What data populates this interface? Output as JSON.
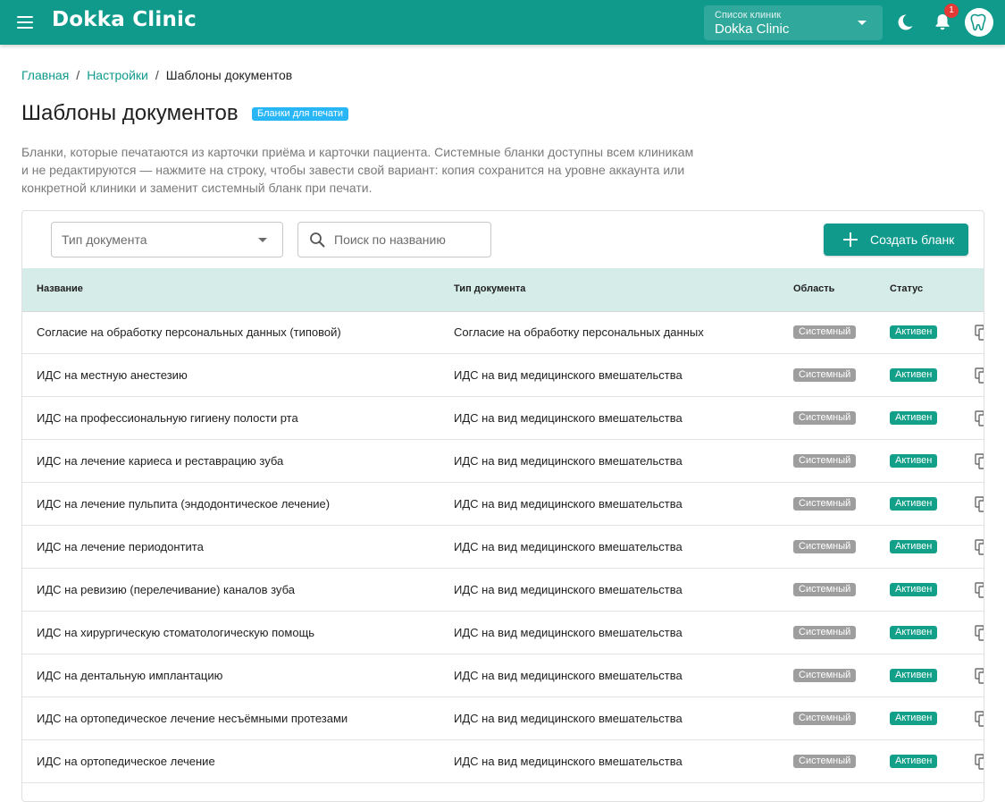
{
  "app": {
    "brand": "Dokka Clinic",
    "clinic_select": {
      "label": "Список клиник",
      "value": "Dokka Clinic"
    },
    "notifications_count": "1",
    "colors": {
      "primary": "#0f9a8c",
      "header_row": "#d5ece9",
      "chip_info": "#29b6f6",
      "chip_system": "#9e9e9e",
      "chip_active": "#12a089",
      "badge": "#e53935"
    }
  },
  "breadcrumb": {
    "home": "Главная",
    "settings": "Настройки",
    "current": "Шаблоны документов"
  },
  "page": {
    "title": "Шаблоны документов",
    "chip": "Бланки для печати",
    "description": "Бланки, которые печатаются из карточки приёма и карточки пациента. Системные бланки доступны всем клиникам и не редактируются — нажмите на строку, чтобы завести свой вариант: копия сохранится на уровне аккаунта или конкретной клиники и заменит системный бланк при печати."
  },
  "toolbar": {
    "type_filter_placeholder": "Тип документа",
    "search_placeholder": "Поиск по названию",
    "create_label": "Создать бланк"
  },
  "table": {
    "headers": {
      "name": "Название",
      "type": "Тип документа",
      "scope": "Область",
      "status": "Статус"
    },
    "rows": [
      {
        "name": "Согласие на обработку персональных данных (типовой)",
        "type": "Согласие на обработку персональных данных",
        "scope": "Системный",
        "status": "Активен"
      },
      {
        "name": "ИДС на местную анестезию",
        "type": "ИДС на вид медицинского вмешательства",
        "scope": "Системный",
        "status": "Активен"
      },
      {
        "name": "ИДС на профессиональную гигиену полости рта",
        "type": "ИДС на вид медицинского вмешательства",
        "scope": "Системный",
        "status": "Активен"
      },
      {
        "name": "ИДС на лечение кариеса и реставрацию зуба",
        "type": "ИДС на вид медицинского вмешательства",
        "scope": "Системный",
        "status": "Активен"
      },
      {
        "name": "ИДС на лечение пульпита (эндодонтическое лечение)",
        "type": "ИДС на вид медицинского вмешательства",
        "scope": "Системный",
        "status": "Активен"
      },
      {
        "name": "ИДС на лечение периодонтита",
        "type": "ИДС на вид медицинского вмешательства",
        "scope": "Системный",
        "status": "Активен"
      },
      {
        "name": "ИДС на ревизию (перелечивание) каналов зуба",
        "type": "ИДС на вид медицинского вмешательства",
        "scope": "Системный",
        "status": "Активен"
      },
      {
        "name": "ИДС на хирургическую стоматологическую помощь",
        "type": "ИДС на вид медицинского вмешательства",
        "scope": "Системный",
        "status": "Активен"
      },
      {
        "name": "ИДС на дентальную имплантацию",
        "type": "ИДС на вид медицинского вмешательства",
        "scope": "Системный",
        "status": "Активен"
      },
      {
        "name": "ИДС на ортопедическое лечение несъёмными протезами",
        "type": "ИДС на вид медицинского вмешательства",
        "scope": "Системный",
        "status": "Активен"
      },
      {
        "name": "ИДС на ортопедическое лечение",
        "type": "ИДС на вид медицинского вмешательства",
        "scope": "Системный",
        "status": "Активен"
      }
    ]
  }
}
